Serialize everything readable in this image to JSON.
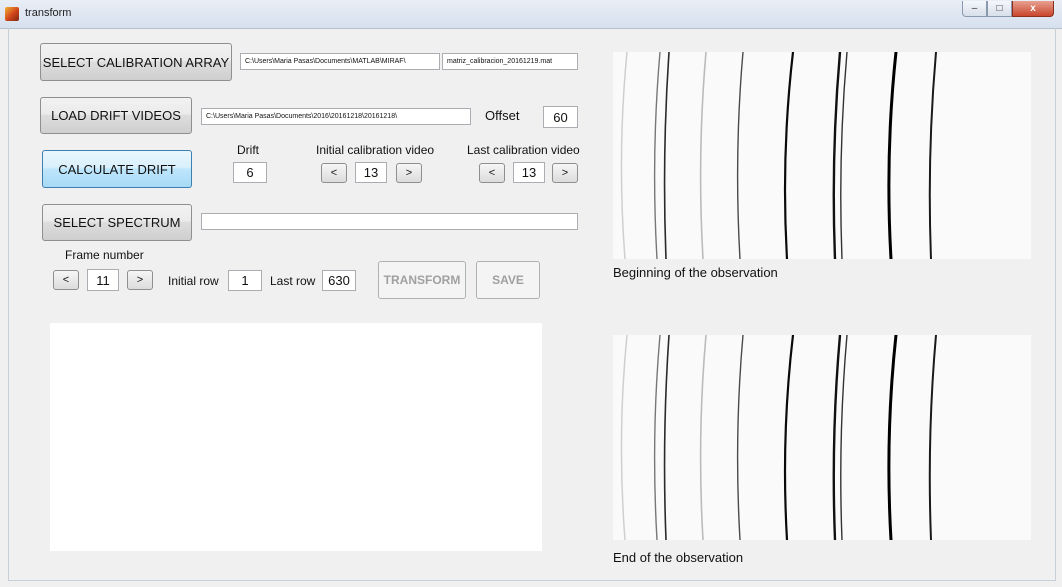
{
  "window": {
    "title": "transform",
    "buttons": {
      "minimize": "–",
      "maximize": "□",
      "close": "x"
    }
  },
  "calibration": {
    "button_label": "SELECT CALIBRATION ARRAY",
    "path": "C:\\Users\\Maria Pasas\\Documents\\MATLAB\\MIRAF\\",
    "file": "matriz_calibracion_20161219.mat"
  },
  "drift_videos": {
    "button_label": "LOAD DRIFT VIDEOS",
    "path": "C:\\Users\\Maria Pasas\\Documents\\2016\\20161218\\20161218\\",
    "offset_label": "Offset",
    "offset_value": "60"
  },
  "drift": {
    "button_label": "CALCULATE DRIFT",
    "drift_label": "Drift",
    "drift_value": "6",
    "initial_label": "Initial calibration video",
    "initial_value": "13",
    "last_label": "Last calibration video",
    "last_value": "13",
    "prev": "<",
    "next": ">"
  },
  "spectrum": {
    "button_label": "SELECT SPECTRUM",
    "path": ""
  },
  "frame": {
    "label": "Frame number",
    "value": "11",
    "prev": "<",
    "next": ">",
    "initial_row_label": "Initial row",
    "initial_row_value": "1",
    "last_row_label": "Last row",
    "last_row_value": "630",
    "transform_label": "TRANSFORM",
    "save_label": "SAVE"
  },
  "images": {
    "beginning_caption": "Beginning of the observation",
    "end_caption": "End of the observation"
  }
}
